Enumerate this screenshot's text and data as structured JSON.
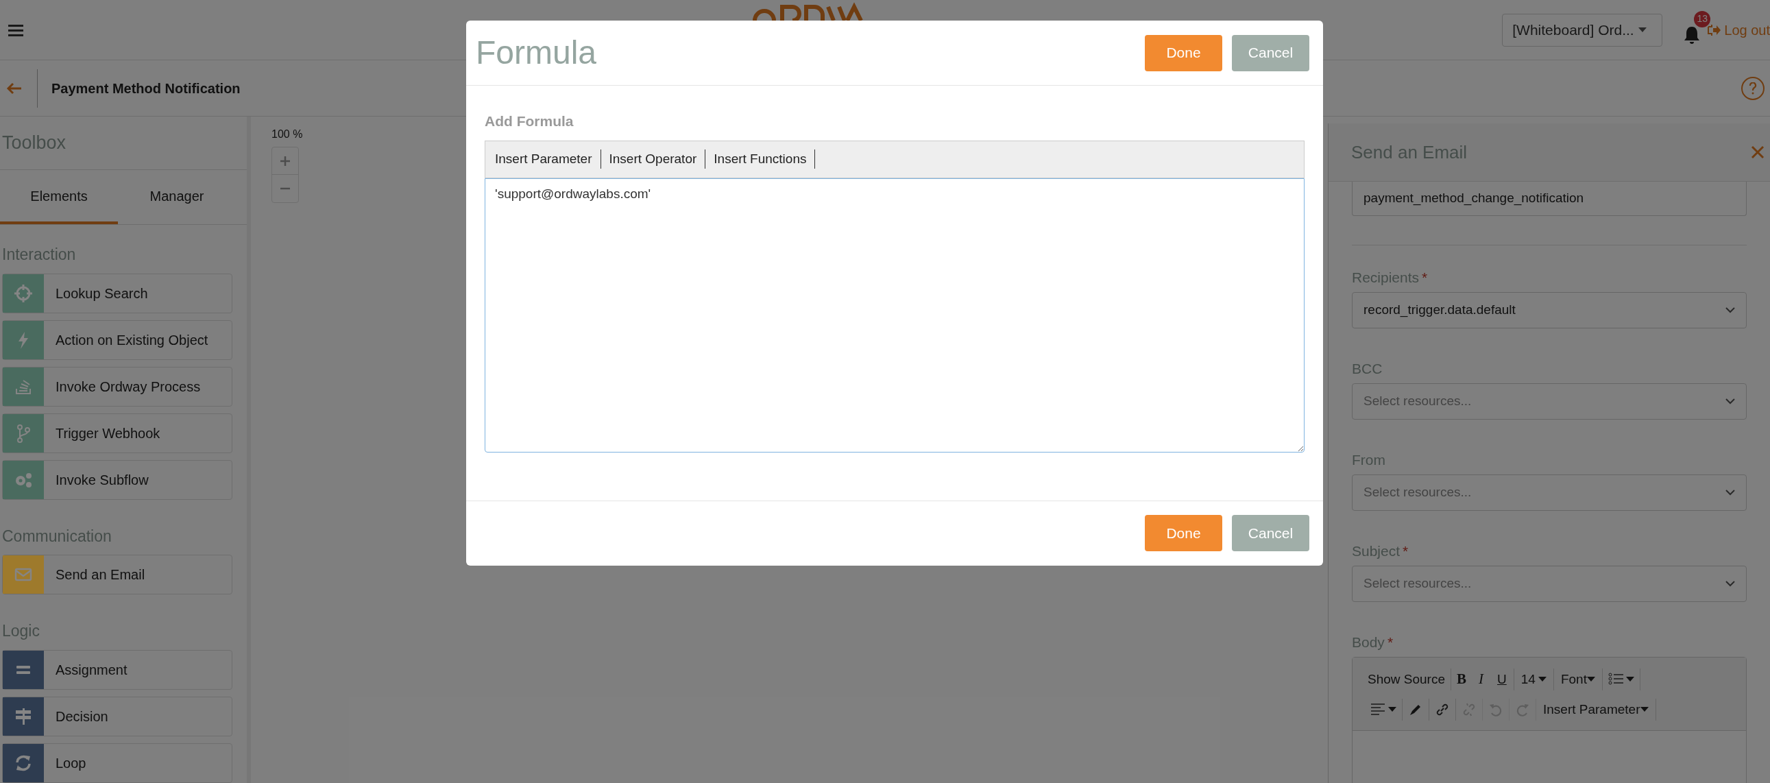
{
  "top_bar": {
    "account_select": "[Whiteboard] Ord...",
    "notification_count": "13",
    "logout": "Log out"
  },
  "page_header": {
    "title": "Payment Method Notification"
  },
  "toolbox": {
    "title": "Toolbox",
    "tabs": [
      {
        "label": "Elements",
        "selected": true
      },
      {
        "label": "Manager",
        "selected": false
      }
    ],
    "sections": [
      {
        "title": "Interaction",
        "color": "#4a6b5f",
        "items": [
          "Lookup Search",
          "Action on Existing Object",
          "Invoke Ordway Process",
          "Trigger Webhook",
          "Invoke Subflow"
        ]
      },
      {
        "title": "Communication",
        "color": "#9e7a2c",
        "items": [
          "Send an Email"
        ]
      },
      {
        "title": "Logic",
        "color": "#2e3c50",
        "items": [
          "Assignment",
          "Decision",
          "Loop"
        ]
      }
    ]
  },
  "canvas": {
    "zoom": "100 %"
  },
  "panel": {
    "title": "Send an Email",
    "name_value": "payment_method_change_notification",
    "fields": [
      {
        "label": "Recipients",
        "required_mark": "*",
        "value": "record_trigger.data.default"
      },
      {
        "label": "BCC",
        "placeholder": "Select resources..."
      },
      {
        "label": "From",
        "placeholder": "Select resources..."
      },
      {
        "label": "Subject",
        "required_mark": "*",
        "placeholder": "Select resources..."
      }
    ],
    "body": {
      "label": "Body",
      "required_mark": "*",
      "toolbar_rows": [
        [
          {
            "kind": "text",
            "label": "Show Source"
          },
          {
            "kind": "bold",
            "label": "B"
          },
          {
            "kind": "italic",
            "label": "I"
          },
          {
            "kind": "underline",
            "label": "U"
          },
          {
            "kind": "dropdown",
            "label": "14"
          },
          {
            "kind": "dropdown",
            "label": "Font"
          },
          {
            "kind": "icon-dropdown",
            "disabled": false
          }
        ],
        [
          {
            "kind": "icon-dropdown",
            "disabled": false
          },
          {
            "kind": "icon",
            "disabled": false
          },
          {
            "kind": "icon",
            "disabled": false
          },
          {
            "kind": "icon",
            "disabled": true
          },
          {
            "kind": "icon",
            "disabled": true
          },
          {
            "kind": "icon",
            "disabled": true
          },
          {
            "kind": "dropdown",
            "label": "Insert Parameter"
          }
        ]
      ]
    }
  },
  "modal": {
    "title": "Formula",
    "header_buttons": [
      {
        "label": "Done",
        "kind": "primary"
      },
      {
        "label": "Cancel",
        "kind": "secondary"
      }
    ],
    "section_label": "Add Formula",
    "toolbar": [
      "Insert Parameter",
      "Insert Operator",
      "Insert Functions"
    ],
    "formula": "'support@ordwaylabs.com'",
    "footer_buttons": [
      {
        "label": "Done",
        "kind": "primary"
      },
      {
        "label": "Cancel",
        "kind": "secondary"
      }
    ]
  }
}
